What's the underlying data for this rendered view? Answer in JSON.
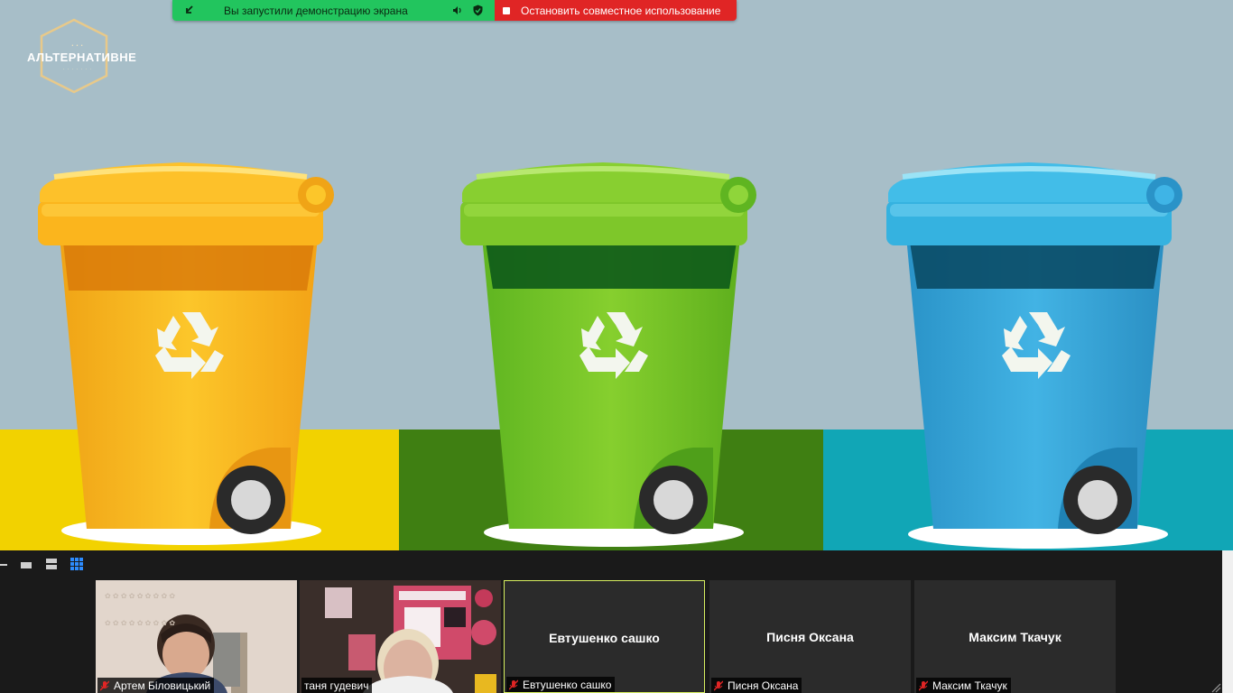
{
  "share_banner": {
    "status_text": "Вы запустили демонстрацию экрана",
    "stop_label": "Остановить совместное использование",
    "green_color": "#22c55e",
    "red_color": "#e02525"
  },
  "slide": {
    "logo_text": "АЛЬТЕРНАТИВНЕ",
    "bins": [
      {
        "color": "yellow",
        "recycle_icon": "recycle-icon"
      },
      {
        "color": "green",
        "recycle_icon": "recycle-icon"
      },
      {
        "color": "blue",
        "recycle_icon": "recycle-icon"
      }
    ]
  },
  "gallery": {
    "participants": [
      {
        "name": "Артем Біловицький",
        "video": true,
        "muted": true
      },
      {
        "name": "таня гудевич",
        "video": true,
        "muted": false
      },
      {
        "name": "Евтушенко сашко",
        "video": false,
        "muted": true,
        "active_speaker": true
      },
      {
        "name": "Писня Оксана",
        "video": false,
        "muted": true
      },
      {
        "name": "Максим Ткачук",
        "video": false,
        "muted": true
      }
    ]
  }
}
